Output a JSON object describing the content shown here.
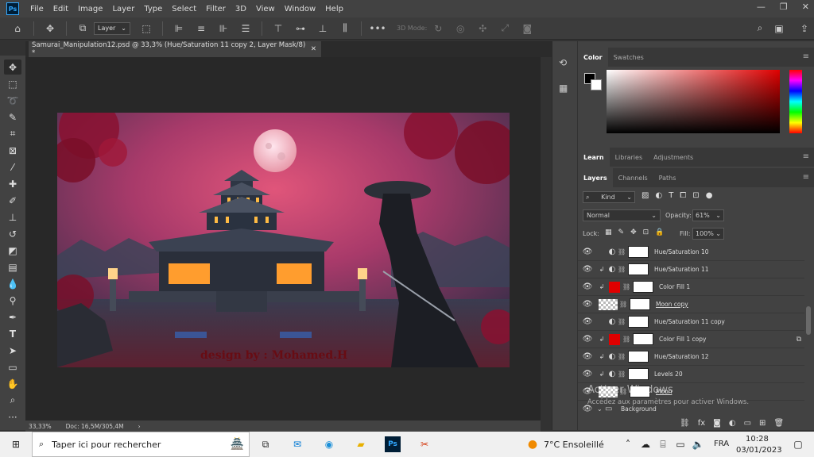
{
  "app": {
    "logo": "Ps"
  },
  "menu": [
    "File",
    "Edit",
    "Image",
    "Layer",
    "Type",
    "Select",
    "Filter",
    "3D",
    "View",
    "Window",
    "Help"
  ],
  "options": {
    "layer_select": "Layer",
    "mode_3d": "3D Mode:"
  },
  "document": {
    "tab_title": "Samurai_Manipulation12.psd @ 33,3% (Hue/Saturation 11 copy 2, Layer Mask/8) *",
    "watermark": "design by : Mohamed.H"
  },
  "status": {
    "zoom": "33,33%",
    "doc_size": "Doc: 16,5M/305,4M"
  },
  "color_panel": {
    "tabs": [
      "Color",
      "Swatches"
    ]
  },
  "learn_panel": {
    "tabs": [
      "Learn",
      "Libraries",
      "Adjustments"
    ]
  },
  "layers_panel": {
    "tabs": [
      "Layers",
      "Channels",
      "Paths"
    ],
    "filter_kind": "Kind",
    "blend_mode": "Normal",
    "opacity_label": "Opacity:",
    "opacity_value": "61%",
    "lock_label": "Lock:",
    "fill_label": "Fill:",
    "fill_value": "100%",
    "layers": [
      {
        "name": "Hue/Saturation 10",
        "type": "adjustment",
        "clip": false
      },
      {
        "name": "Hue/Saturation 11",
        "type": "adjustment",
        "clip": true
      },
      {
        "name": "Color Fill 1",
        "type": "fill",
        "clip": true
      },
      {
        "name": "Moon copy",
        "type": "pixel",
        "clip": false
      },
      {
        "name": "Hue/Saturation 11 copy",
        "type": "adjustment",
        "clip": false
      },
      {
        "name": "Color Fill 1 copy",
        "type": "fill",
        "clip": true
      },
      {
        "name": "Hue/Saturation 12",
        "type": "adjustment",
        "clip": true
      },
      {
        "name": "Levels 20",
        "type": "adjustment",
        "clip": true
      },
      {
        "name": "Moon",
        "type": "pixel",
        "clip": false
      },
      {
        "name": "Background",
        "type": "group",
        "clip": false
      }
    ]
  },
  "activation": {
    "title": "Activer Windows",
    "subtitle": "Accédez aux paramètres pour activer Windows."
  },
  "taskbar": {
    "search_placeholder": "Taper ici pour rechercher",
    "weather": "7°C  Ensoleillé",
    "language": "FRA",
    "time": "10:28",
    "date": "03/01/2023"
  },
  "colors": {
    "accent": "#31a8ff",
    "fg_swatch": "#000000",
    "bg_swatch": "#ffffff",
    "fill_red": "#e00000"
  }
}
